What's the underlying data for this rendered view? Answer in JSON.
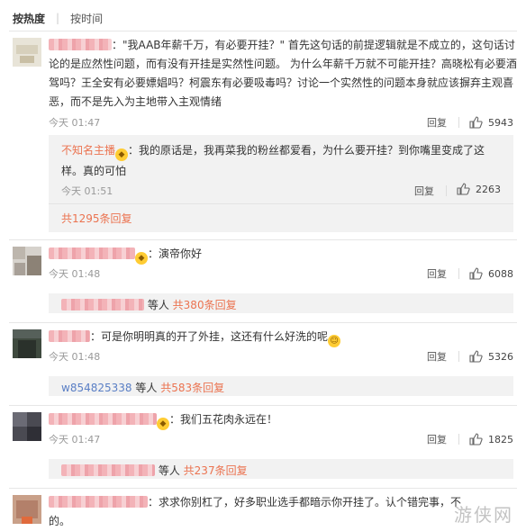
{
  "tabs": {
    "hot": "按热度",
    "time": "按时间"
  },
  "comments": [
    {
      "text_line1": "：\"我AAB年薪千万，有必要开挂？\" 首先这句话的前提逻辑就是不成立的，这句话讨",
      "text_line2": "论的是应然性问题，而有没有开挂是实然性问题。 为什么年薪千万就不可能开挂？高晓松有必要酒",
      "text_line3": "驾吗？王全安有必要嫖娼吗？柯震东有必要吸毒吗？讨论一个实然性的问题本身就应该摒弃主观喜",
      "text_line4": "恶，而不是先入为主地带入主观情绪",
      "time": "今天 01:47",
      "reply": "回复",
      "likes": "5943",
      "sub": {
        "author": "不知名主播",
        "text_line1": "：我的原话是，我再菜我的粉丝都爱看，为什么要开挂？到你嘴里变成了这",
        "text_line2": "样。真的可怕",
        "time": "今天 01:51",
        "reply": "回复",
        "likes": "2263",
        "more": "共1295条回复"
      }
    },
    {
      "text": "：演帝你好",
      "time": "今天 01:48",
      "reply": "回复",
      "likes": "6088",
      "replies_prefix": "等人",
      "replies_count": "共380条回复"
    },
    {
      "text": "：可是你明明真的开了外挂，这还有什么好洗的呢",
      "time": "今天 01:48",
      "reply": "回复",
      "likes": "5326",
      "replier": "w854825338",
      "replies_prefix": "等人",
      "replies_count": "共583条回复"
    },
    {
      "text": "：我们五花肉永远在！",
      "time": "今天 01:47",
      "reply": "回复",
      "likes": "1825",
      "replies_prefix": "等人",
      "replies_count": "共237条回复"
    },
    {
      "text_line1": "：求求你别杠了，好多职业选手都暗示你开挂了。认个错完事，不",
      "text_line2": "的。"
    }
  ],
  "watermark": "游侠网",
  "colors": {
    "accent": "#eb7350",
    "link_blue": "#5a7fc5"
  }
}
